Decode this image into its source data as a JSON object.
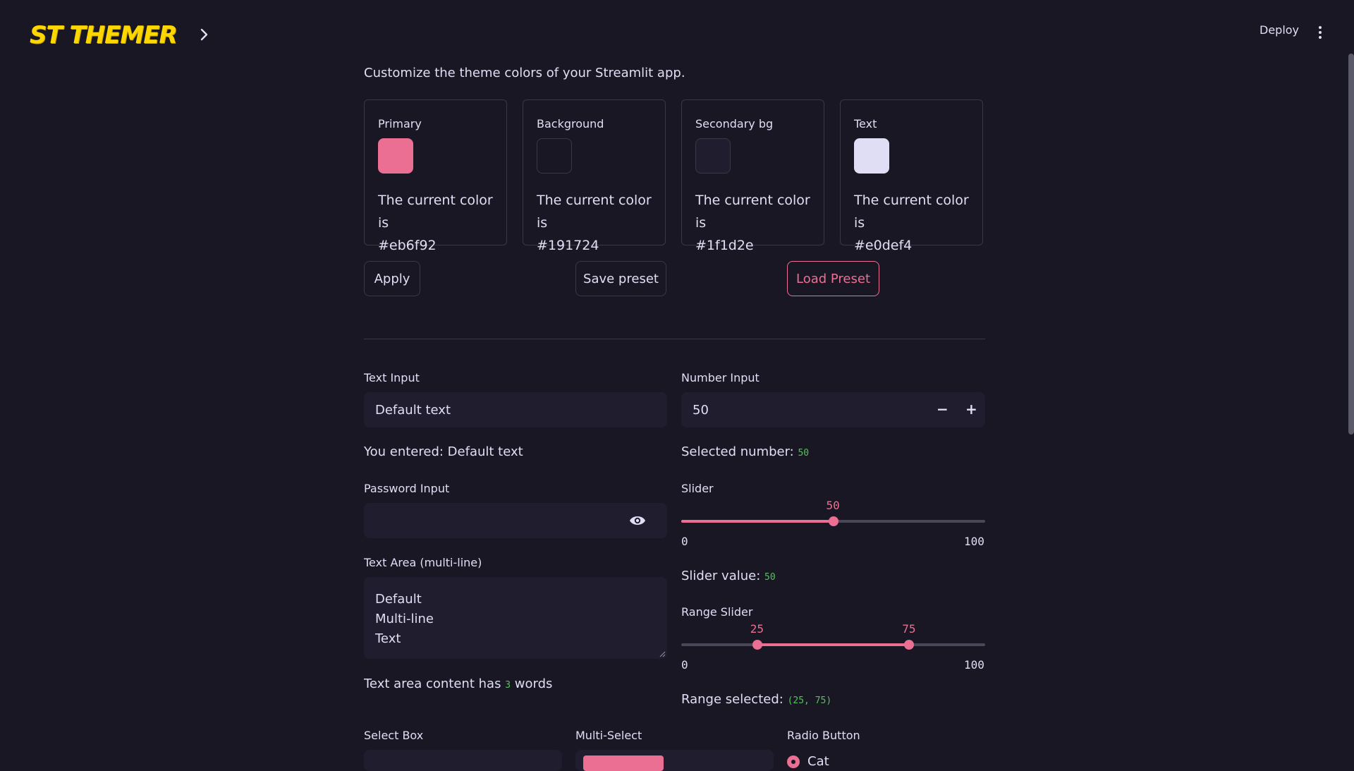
{
  "header": {
    "logo_text": "ST THEMER",
    "deploy_label": "Deploy"
  },
  "intro": "Customize the theme colors of your Streamlit app.",
  "colors": [
    {
      "label": "Primary",
      "caption": "The current color is",
      "value": "#eb6f92"
    },
    {
      "label": "Background",
      "caption": "The current color is",
      "value": "#191724"
    },
    {
      "label": "Secondary bg",
      "caption": "The current color is",
      "value": "#1f1d2e"
    },
    {
      "label": "Text",
      "caption": "The current color is",
      "value": "#e0def4"
    }
  ],
  "buttons": {
    "apply": "Apply",
    "save_preset": "Save preset",
    "load_preset": "Load Preset"
  },
  "text_input": {
    "label": "Text Input",
    "value": "Default text",
    "echo_prefix": "You entered:",
    "echo_value": "Default text"
  },
  "number_input": {
    "label": "Number Input",
    "value": "50",
    "minus": "−",
    "plus": "+",
    "echo_label": "Selected number:",
    "echo_value": "50"
  },
  "password_input": {
    "label": "Password Input",
    "value": ""
  },
  "slider": {
    "label": "Slider",
    "value": 50,
    "min": 0,
    "max": 100,
    "value_text": "50",
    "min_text": "0",
    "max_text": "100",
    "echo_label": "Slider value:",
    "echo_value": "50"
  },
  "text_area": {
    "label": "Text Area (multi-line)",
    "lines": [
      "Default",
      "Multi-line",
      "Text"
    ],
    "echo_prefix": "Text area content has",
    "echo_count": "3",
    "echo_suffix": "words"
  },
  "range_slider": {
    "label": "Range Slider",
    "low": 25,
    "high": 75,
    "min": 0,
    "max": 100,
    "low_text": "25",
    "high_text": "75",
    "min_text": "0",
    "max_text": "100",
    "echo_label": "Range selected:",
    "echo_value": "(25, 75)"
  },
  "select_box": {
    "label": "Select Box"
  },
  "multi_select": {
    "label": "Multi-Select"
  },
  "radio": {
    "label": "Radio Button",
    "first_option": "Cat"
  }
}
